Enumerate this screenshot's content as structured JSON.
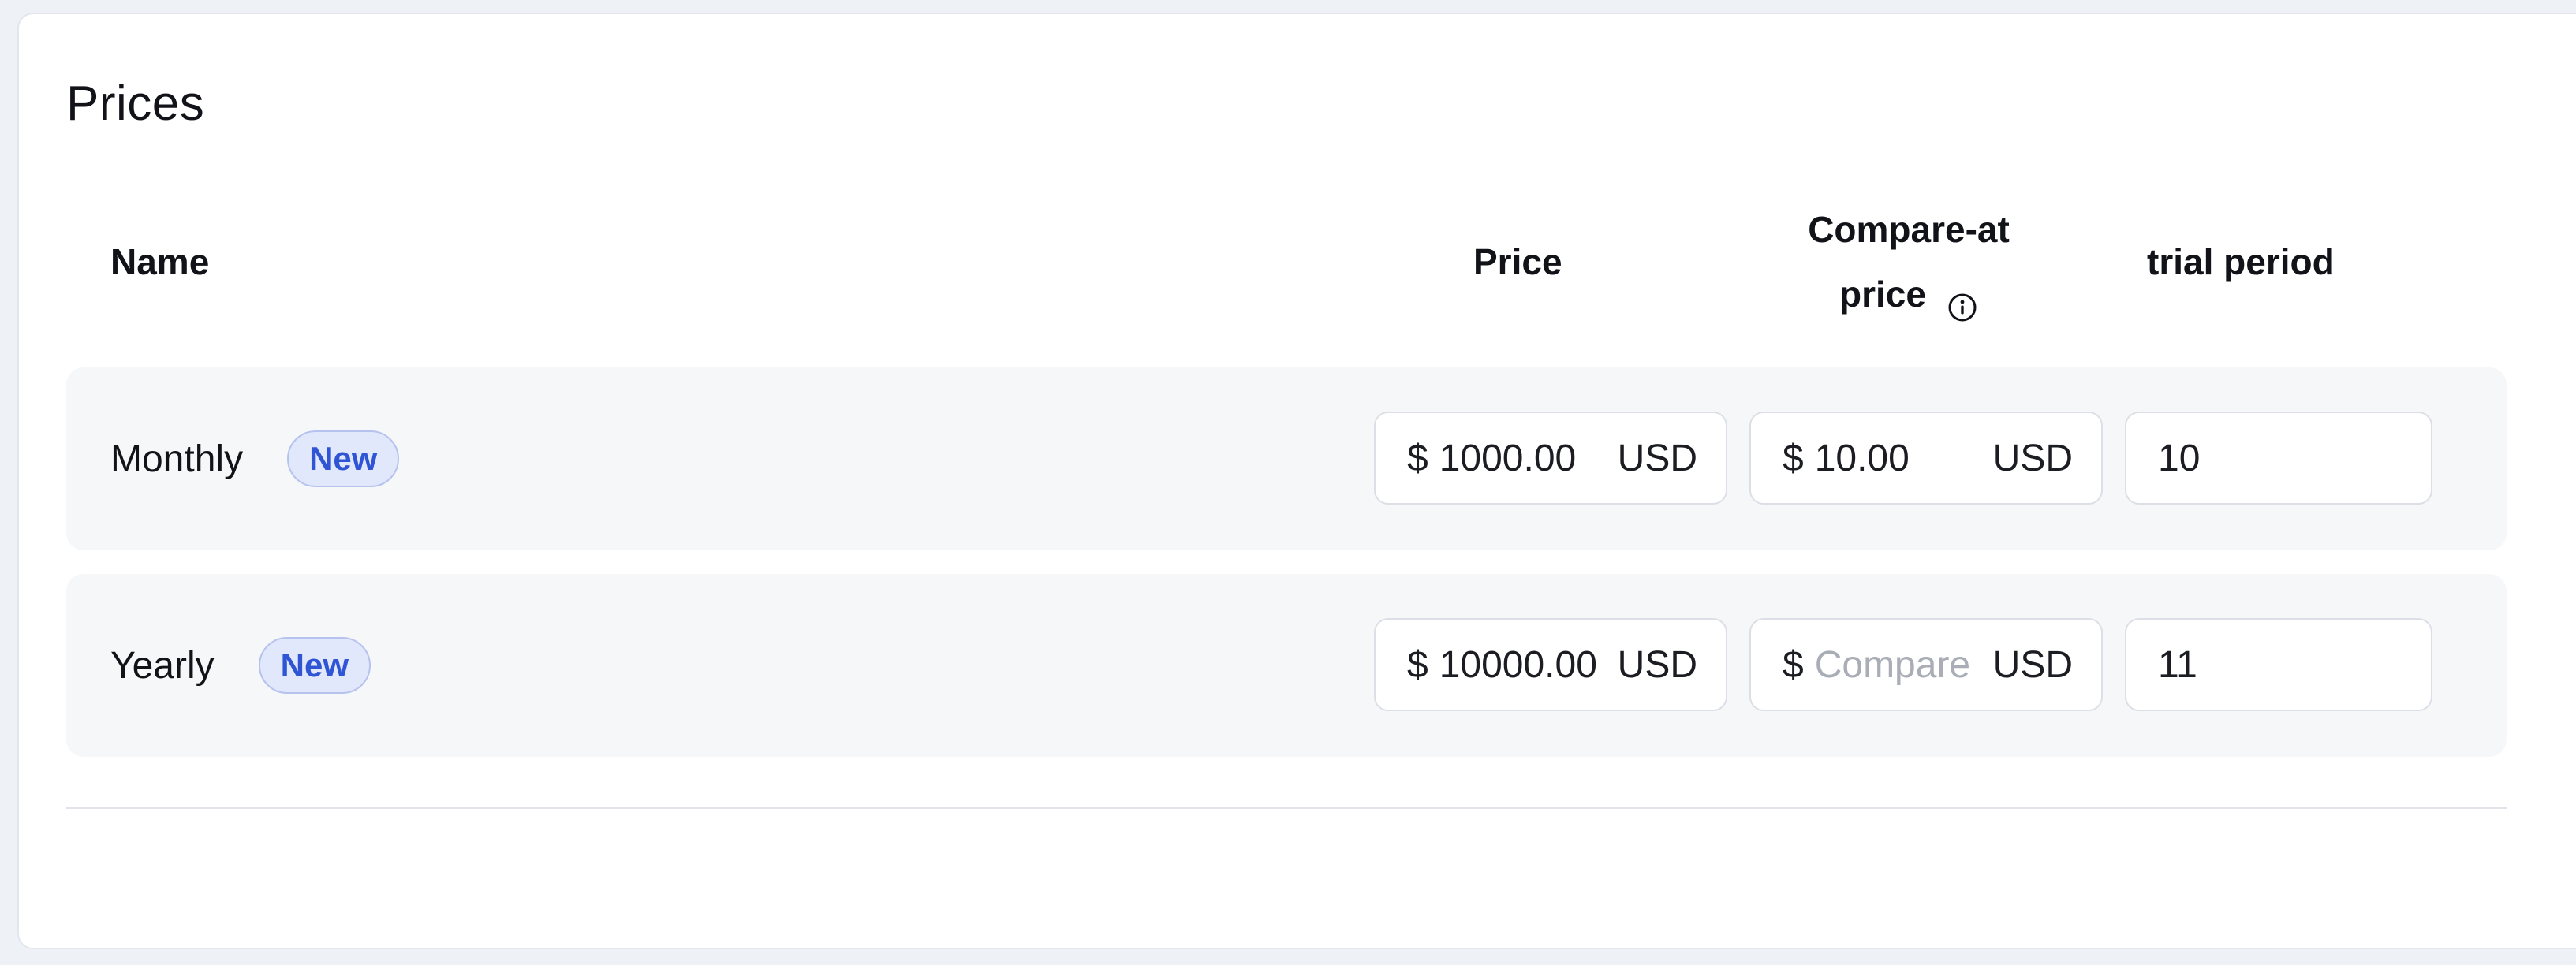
{
  "section": {
    "title": "Prices"
  },
  "table": {
    "headers": {
      "name": "Name",
      "price": "Price",
      "compare_line1": "Compare-at",
      "compare_line2": "price",
      "trial": "trial period"
    },
    "icons": {
      "compare_info": "info-circle-icon"
    },
    "rows": [
      {
        "name": "Monthly",
        "badge": "New",
        "price": {
          "currency_symbol": "$",
          "value": "1000.00",
          "unit": "USD"
        },
        "compare": {
          "currency_symbol": "$",
          "value": "10.00",
          "placeholder": "",
          "unit": "USD"
        },
        "trial": "10"
      },
      {
        "name": "Yearly",
        "badge": "New",
        "price": {
          "currency_symbol": "$",
          "value": "10000.00",
          "unit": "USD"
        },
        "compare": {
          "currency_symbol": "$",
          "value": "",
          "placeholder": "Compare",
          "unit": "USD"
        },
        "trial": "11"
      }
    ]
  },
  "colors": {
    "badge_text": "#2f55d4",
    "badge_bg": "#e2e8fb",
    "row_bg": "#f6f7f9",
    "placeholder": "#a9adb5"
  }
}
